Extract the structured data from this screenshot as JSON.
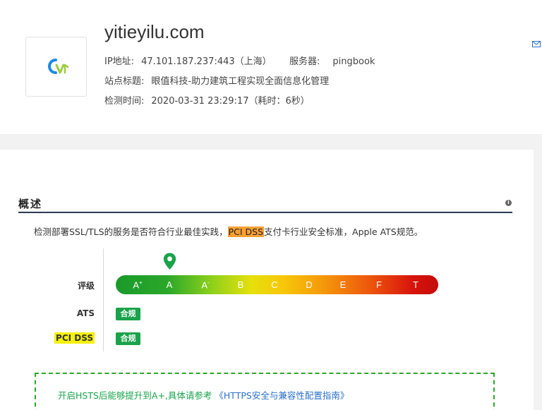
{
  "header": {
    "domain": "yitieyilu.com",
    "ip_label": "IP地址:",
    "ip_value": "47.101.187.237:443（上海）",
    "server_label": "服务器:",
    "server_value": "pingbook",
    "title_label": "站点标题:",
    "title_value": "眼值科技-助力建筑工程实现全面信息化管理",
    "time_label": "检测时间:",
    "time_value": "2020-03-31 23:29:17（耗时：6秒）"
  },
  "overview": {
    "section_title": "概述",
    "info_symbol": "i",
    "desc_before": "检测部署SSL/TLS的服务是否符合行业最佳实践，",
    "desc_highlight": "PCI DSS",
    "desc_after": "支付卡行业安全标准，Apple ATS规范。",
    "rating_label": "评级",
    "grades": [
      "A",
      "A",
      "A",
      "B",
      "C",
      "D",
      "E",
      "F",
      "T"
    ],
    "grade_suffixes": [
      "+",
      "",
      "-",
      "",
      "",
      "",
      "",
      "",
      ""
    ],
    "current_grade_index": 1,
    "ats_label": "ATS",
    "ats_status": "合规",
    "pci_label": "PCI DSS",
    "pci_status": "合规"
  },
  "hint": {
    "text": "开启HSTS后能够提升到A+,具体请参考",
    "link": "《HTTPS安全与兼容性配置指南》"
  },
  "colors": {
    "accent_green": "#1aa34a",
    "highlight_orange": "#f7a034",
    "highlight_yellow": "#f5f10b",
    "rule_navy": "#2b3a52"
  }
}
